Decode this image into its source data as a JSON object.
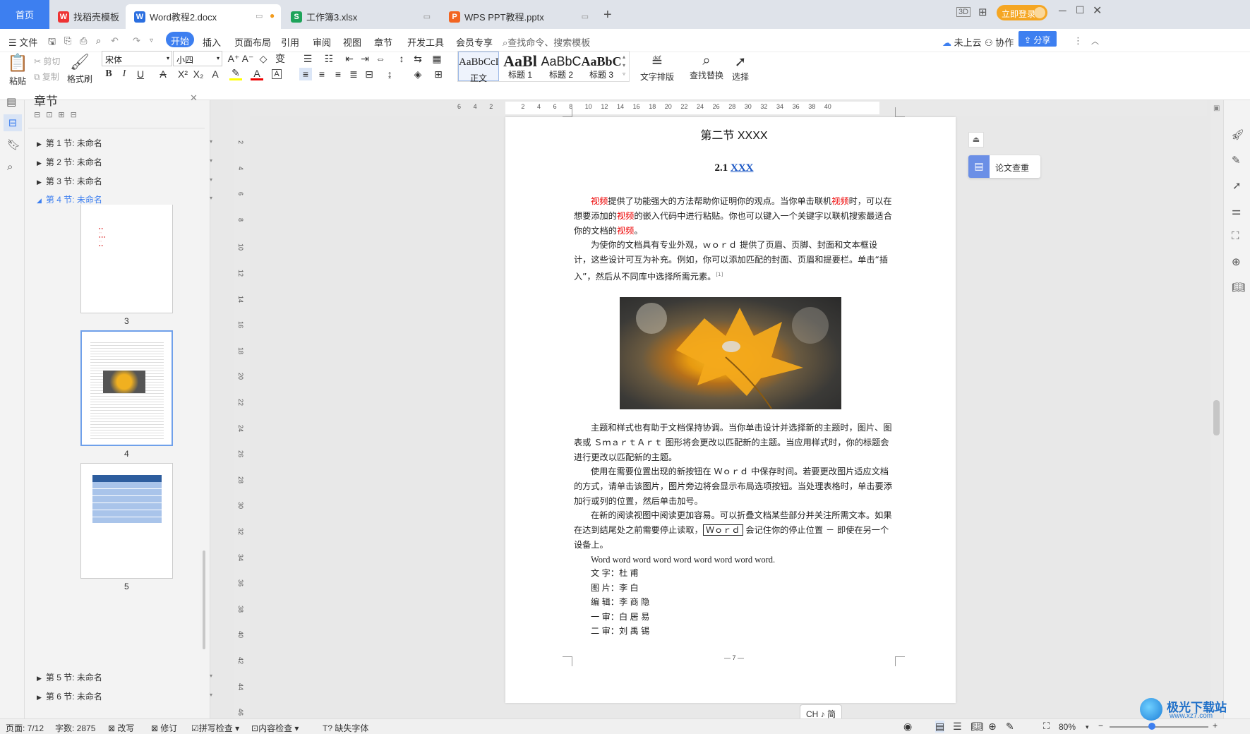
{
  "tabs": {
    "home": "首页",
    "t1": "找稻壳模板",
    "t2": "Word教程2.docx",
    "t3": "工作簿3.xlsx",
    "t4": "WPS PPT教程.pptx",
    "plus": "+"
  },
  "titlebar_right": {
    "login": "立即登录"
  },
  "menu": {
    "file": "文件",
    "items": [
      "开始",
      "插入",
      "页面布局",
      "引用",
      "审阅",
      "视图",
      "章节",
      "开发工具",
      "会员专享"
    ],
    "search": "查找命令、搜索模板",
    "cloud": "未上云",
    "collab": "协作",
    "share": "分享"
  },
  "ribbon": {
    "paste": "粘贴",
    "cut": "剪切",
    "copy": "复制",
    "format_painter": "格式刷",
    "font": "宋体",
    "size": "小四",
    "styles": [
      {
        "sample": "AaBbCcI",
        "label": "正文"
      },
      {
        "sample": "AaBl",
        "label": "标题 1"
      },
      {
        "sample": "AaBbC",
        "label": "标题 2"
      },
      {
        "sample": "AaBbC",
        "label": "标题 3"
      }
    ],
    "text_layout": "文字排版",
    "find_replace": "查找替换",
    "select": "选择"
  },
  "sidebar": {
    "title": "章节",
    "sections": [
      "第 1 节: 未命名",
      "第 2 节: 未命名",
      "第 3 节: 未命名",
      "第 4 节: 未命名",
      "第 5 节: 未命名",
      "第 6 节: 未命名"
    ],
    "page_nums": [
      "3",
      "4",
      "5"
    ]
  },
  "ruler_h": [
    "6",
    "4",
    "2",
    "",
    "2",
    "4",
    "6",
    "8",
    "10",
    "12",
    "14",
    "16",
    "18",
    "20",
    "22",
    "24",
    "26",
    "28",
    "30",
    "32",
    "34",
    "36",
    "38",
    "40"
  ],
  "ruler_v": [
    "2",
    "4",
    "6",
    "8",
    "10",
    "12",
    "14",
    "16",
    "18",
    "20",
    "22",
    "24",
    "26",
    "28",
    "30",
    "32",
    "34",
    "36",
    "38",
    "40",
    "42",
    "44",
    "46"
  ],
  "doc": {
    "section_title": "第二节  XXXX",
    "heading_num": "2.1",
    "heading_link": "XXX",
    "p1_a": "视频",
    "p1_b": "提供了功能强大的方法帮助你证明你的观点。当你单击联机",
    "p1_c": "视频",
    "p1_d": "时，可以在想要添加的",
    "p1_e": "视频",
    "p1_f": "的嵌入代码中进行粘贴。你也可以键入一个关键字以联机搜索最适合你的文档的",
    "p1_g": "视频",
    "p1_h": "。",
    "p2": "为使你的文档具有专业外观，ｗｏｒｄ  提供了页眉、页脚、封面和文本框设计，这些设计可互为补充。例如，你可以添加匹配的封面、页眉和提要栏。单击“插入”，然后从不同库中选择所需元素。",
    "p2_ref": "[1]",
    "p3": "主题和样式也有助于文档保持协调。当你单击设计并选择新的主题时，图片、图表或  ＳｍａｒｔＡｒｔ  图形将会更改以匹配新的主题。当应用样式时，你的标题会进行更改以匹配新的主题。",
    "p4": "使用在需要位置出现的新按钮在  Ｗｏｒｄ  中保存时间。若要更改图片适应文档的方式，请单击该图片，图片旁边将会显示布局选项按钮。当处理表格时，单击要添加行或列的位置，然后单击加号。",
    "p5_a": "在新的阅读视图中阅读更加容易。可以折叠文档某些部分并关注所需文本。如果在达到结尾处之前需要停止读取，",
    "p5_box": "Ｗｏｒｄ",
    "p5_b": "  会记住你的停止位置  －  即使在另一个设备上。",
    "p6": "Word word word word word word word word word.",
    "credits": [
      {
        "k": "文  字：",
        "v": "杜    甫"
      },
      {
        "k": "图  片：",
        "v": "李    白"
      },
      {
        "k": "编  辑：",
        "v": "李 商 隐"
      },
      {
        "k": "一  审：",
        "v": "白 居 易"
      },
      {
        "k": "二  审：",
        "v": "刘 禹 锡"
      }
    ],
    "page_footer": "— 7 —"
  },
  "side_panel": {
    "plagiarism": "论文查重"
  },
  "ime": "CH ♪ 简",
  "status": {
    "page": "页面: 7/12",
    "words": "字数: 2875",
    "rewrite": "改写",
    "track": "修订",
    "spell": "拼写检查",
    "content": "内容检查",
    "missing_font": "缺失字体",
    "zoom": "80%"
  },
  "watermark": {
    "text": "极光下载站",
    "url": "www.xz7.com"
  },
  "colors": {
    "accent": "#3d7ff0",
    "login": "#f5a623",
    "red": "#e00000"
  }
}
